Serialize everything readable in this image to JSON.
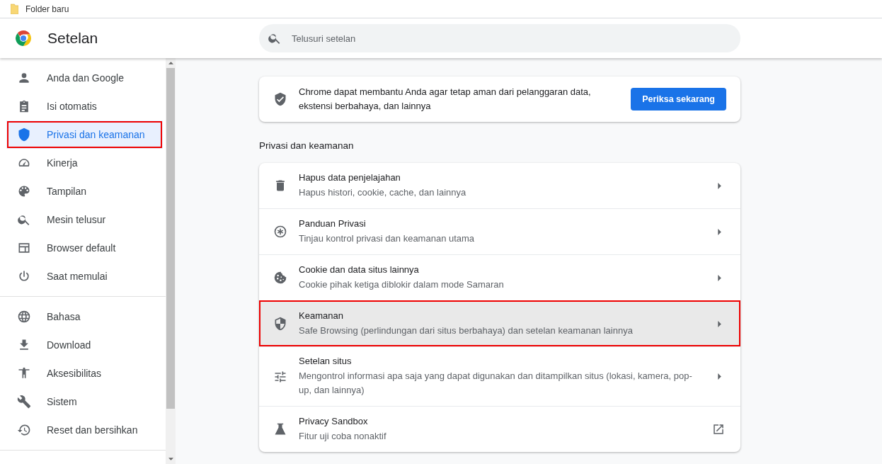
{
  "bookmarks_bar": {
    "items": [
      "Folder baru"
    ]
  },
  "header": {
    "title": "Setelan",
    "search": {
      "placeholder": "Telusuri setelan"
    }
  },
  "sidebar": {
    "groups": [
      [
        {
          "label": "Anda dan Google",
          "selected": false,
          "outlined": false
        },
        {
          "label": "Isi otomatis",
          "selected": false,
          "outlined": false
        },
        {
          "label": "Privasi dan keamanan",
          "selected": true,
          "outlined": true
        },
        {
          "label": "Kinerja",
          "selected": false,
          "outlined": false
        },
        {
          "label": "Tampilan",
          "selected": false,
          "outlined": false
        },
        {
          "label": "Mesin telusur",
          "selected": false,
          "outlined": false
        },
        {
          "label": "Browser default",
          "selected": false,
          "outlined": false
        },
        {
          "label": "Saat memulai",
          "selected": false,
          "outlined": false
        }
      ],
      [
        {
          "label": "Bahasa",
          "selected": false,
          "outlined": false
        },
        {
          "label": "Download",
          "selected": false,
          "outlined": false
        },
        {
          "label": "Aksesibilitas",
          "selected": false,
          "outlined": false
        },
        {
          "label": "Sistem",
          "selected": false,
          "outlined": false
        },
        {
          "label": "Reset dan bersihkan",
          "selected": false,
          "outlined": false
        }
      ]
    ]
  },
  "safety_check": {
    "text": "Chrome dapat membantu Anda agar tetap aman dari pelanggaran data, ekstensi berbahaya, dan lainnya",
    "button": "Periksa sekarang"
  },
  "privacy_section": {
    "heading": "Privasi dan keamanan",
    "rows": [
      {
        "title": "Hapus data penjelajahan",
        "subtitle": "Hapus histori, cookie, cache, dan lainnya",
        "kind": "arrow",
        "highlighted": false,
        "outlined": false
      },
      {
        "title": "Panduan Privasi",
        "subtitle": "Tinjau kontrol privasi dan keamanan utama",
        "kind": "arrow",
        "highlighted": false,
        "outlined": false
      },
      {
        "title": "Cookie dan data situs lainnya",
        "subtitle": "Cookie pihak ketiga diblokir dalam mode Samaran",
        "kind": "arrow",
        "highlighted": false,
        "outlined": false
      },
      {
        "title": "Keamanan",
        "subtitle": "Safe Browsing (perlindungan dari situs berbahaya) dan setelan keamanan lainnya",
        "kind": "arrow",
        "highlighted": true,
        "outlined": true
      },
      {
        "title": "Setelan situs",
        "subtitle": "Mengontrol informasi apa saja yang dapat digunakan dan ditampilkan situs (lokasi, kamera, pop-up, dan lainnya)",
        "kind": "arrow",
        "highlighted": false,
        "outlined": false
      },
      {
        "title": "Privacy Sandbox",
        "subtitle": "Fitur uji coba nonaktif",
        "kind": "external",
        "highlighted": false,
        "outlined": false
      }
    ]
  }
}
